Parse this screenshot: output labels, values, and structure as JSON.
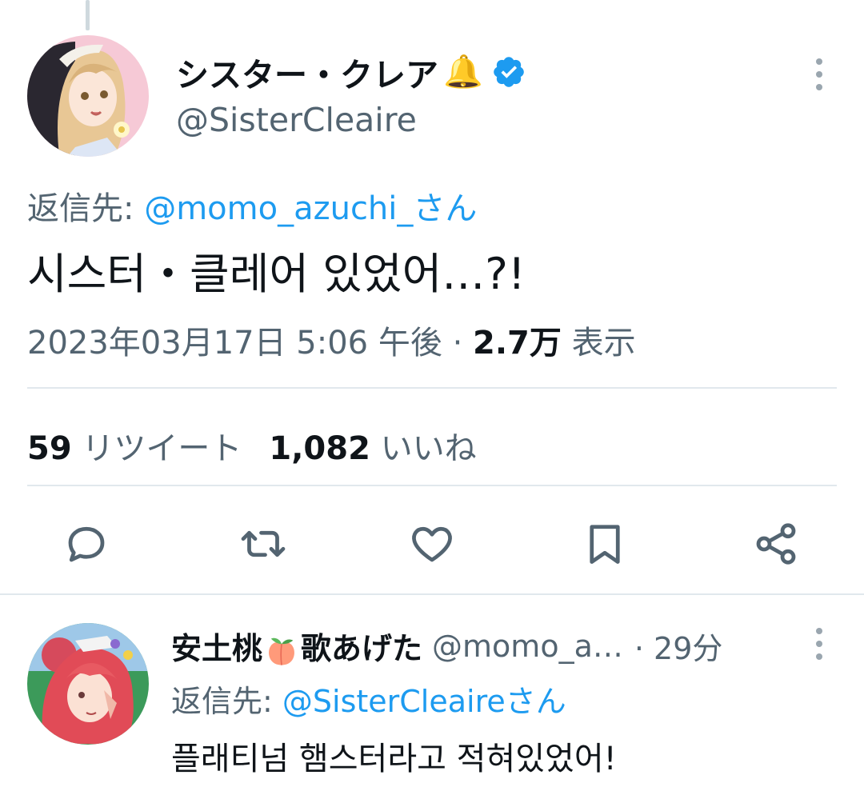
{
  "tweet": {
    "author": {
      "display_name": "シスター・クレア",
      "name_emoji": "🔔",
      "handle": "@SisterCleaire",
      "avatar_icon": "avatar-sister-cleaire"
    },
    "reply_prefix": "返信先: ",
    "reply_mention": "@momo_azuchi_さん",
    "text": "시스터・클레어 있었어…?!",
    "date": "2023年03月17日 5:06 午後",
    "separator": " · ",
    "views_count": "2.7万",
    "views_label": " 表示",
    "retweets_count": "59",
    "retweets_label": " リツイート",
    "likes_count": "1,082",
    "likes_label": " いいね",
    "actions": [
      "reply-icon",
      "retweet-icon",
      "like-icon",
      "bookmark-icon",
      "share-icon"
    ]
  },
  "reply": {
    "display_name_prefix": "安土桃",
    "display_name_suffix": "歌あげた",
    "name_emoji": "peach-emoji",
    "handle": "@momo_a…",
    "time": "· 29分",
    "reply_prefix": "返信先: ",
    "reply_mention": "@SisterCleaireさん",
    "text": "플래티넘 햄스터라고 적혀있었어!"
  },
  "colors": {
    "accent": "#1d9bf0",
    "secondary_text": "#536471",
    "primary_text": "#0f1419",
    "divider": "#e1e8ed"
  }
}
